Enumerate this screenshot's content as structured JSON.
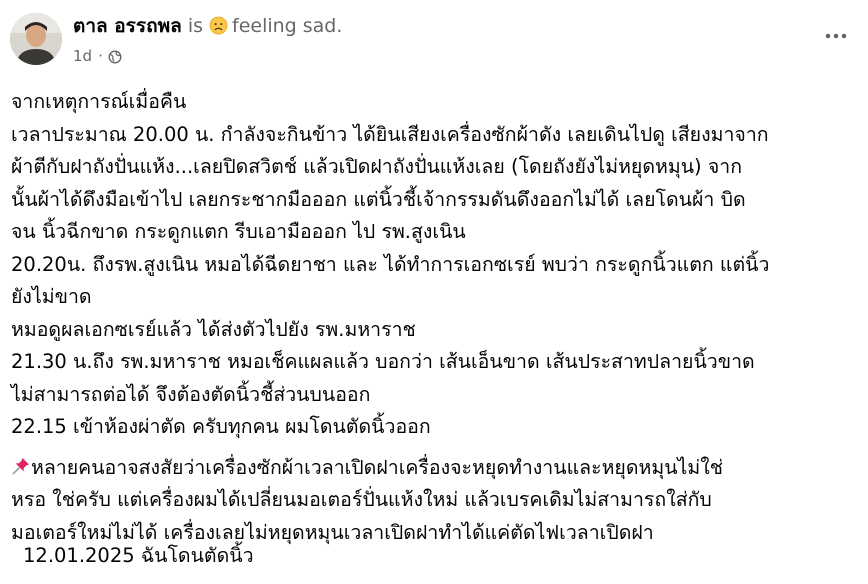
{
  "post": {
    "author": "ตาล อรรถพล",
    "is_word": "is",
    "activity": "feeling sad.",
    "feeling_icon": "sad-face-emoji",
    "timestamp": "1d",
    "audience_icon": "globe-icon",
    "body_lines": [
      "จากเหตุการณ์เมื่อคืน",
      "เวลาประมาณ 20.00 น. กำลังจะกินข้าว ได้ยินเสียงเครื่องซักผ้าดัง เลยเดินไปดู เสียงมาจาก",
      "ผ้าตีกับฝาถังปั่นแห้ง...เลยปิดสวิตช์ แล้วเปิดฝาถังปั่นแห้งเลย (โดยถังยังไม่หยุดหมุน) จาก",
      "นั้นผ้าได้ดึงมือเข้าไป เลยกระชากมือออก แต่นิ้วชี้เจ้ากรรมดันดึงออกไม่ได้ เลยโดนผ้า บิด",
      "จน นิ้วฉีกขาด กระดูกแตก รีบเอามือออก ไป รพ.สูงเนิน",
      "20.20น. ถึงรพ.สูงเนิน หมอได้ฉีดยาชา และ ได้ทำการเอกซเรย์ พบว่า กระดูกนิ้วแตก แต่นิ้ว",
      "ยังไม่ขาด",
      "หมอดูผลเอกซเรย์แล้ว ได้ส่งตัวไปยัง รพ.มหาราช",
      "21.30 น.ถึง รพ.มหาราช หมอเช็คแผลแล้ว บอกว่า เส้นเอ็นขาด เส้นประสาทปลายนิ้วขาด",
      "ไม่สามารถต่อได้ จึงต้องตัดนิ้วชี้ส่วนบนออก",
      "22.15 เข้าห้องผ่าตัด ครับทุกคน ผมโดนตัดนิ้วออก"
    ],
    "note_icon": "pushpin-icon",
    "note_lines": [
      "หลายคนอาจสงสัยว่าเครื่องซักผ้าเวลาเปิดฝาเครื่องจะหยุดทำงานและหยุดหมุนไม่ใช่",
      "หรอ  ใช่ครับ แต่เครื่องผมได้เปลี่ยนมอเตอร์ปั่นแห้งใหม่ แล้วเบรคเดิมไม่สามารถใส่กับ",
      "มอเตอร์ใหม่ไม่ได้ เครื่องเลยไม่หยุดหมุนเวลาเปิดฝาทำได้แค่ตัดไฟเวลาเปิดฝา"
    ],
    "footer_line": "12.01.2025 ฉันโดนตัดนิ้ว"
  },
  "colors": {
    "text_primary": "#050505",
    "text_secondary": "#65676b",
    "background": "#ffffff",
    "pushpin": "#e0245e"
  }
}
